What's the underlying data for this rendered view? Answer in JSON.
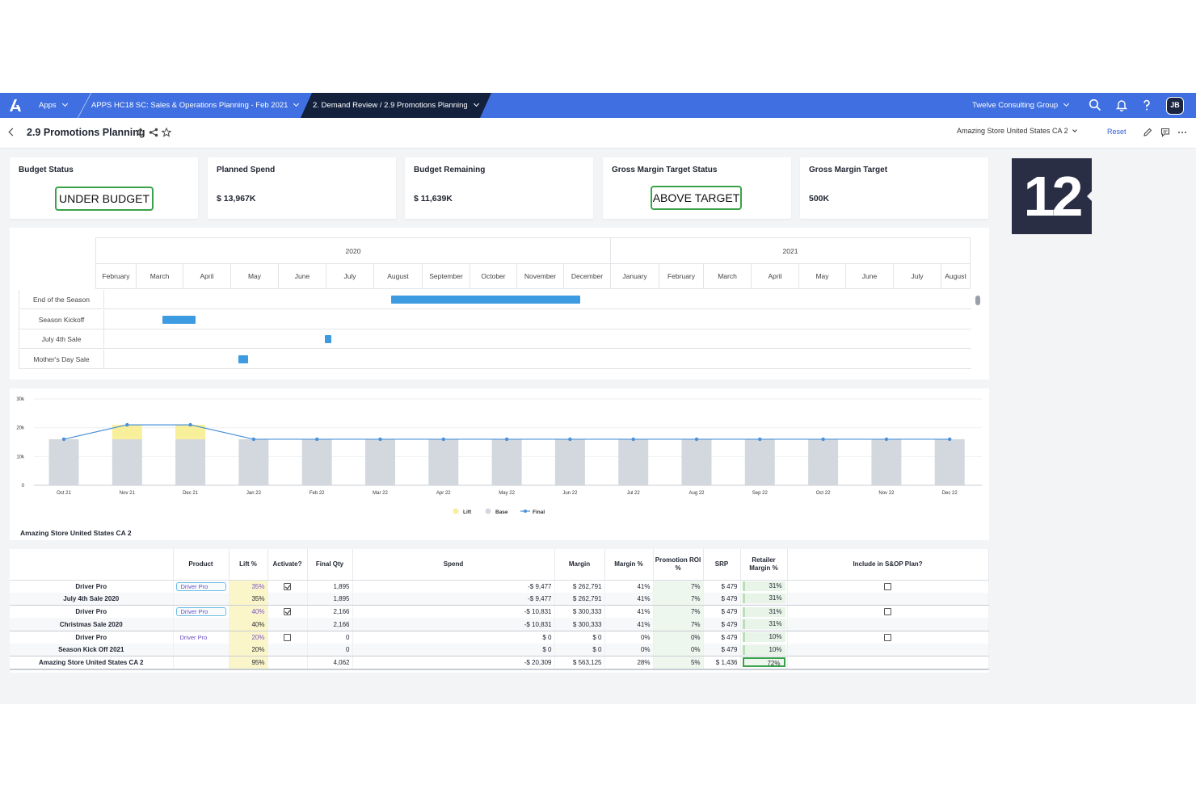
{
  "topbar": {
    "apps_label": "Apps",
    "model_label": "APPS HC18 SC: Sales & Operations Planning - Feb 2021",
    "page_path": "2. Demand Review / 2.9 Promotions Planning",
    "workspace_label": "Twelve Consulting Group",
    "avatar_initials": "JB",
    "icons": [
      "anaplan-logo-icon",
      "search-icon",
      "bell-icon",
      "help-icon"
    ]
  },
  "page_header": {
    "title": "2.9 Promotions Planning",
    "store_select": "Amazing Store United States CA 2",
    "reset_label": "Reset",
    "icons": [
      "back-chevron-icon",
      "refresh-icon",
      "share-icon",
      "star-icon",
      "edit-icon",
      "comment-icon",
      "more-icon"
    ]
  },
  "kpis": [
    {
      "label": "Budget Status",
      "badge": "UNDER BUDGET"
    },
    {
      "label": "Planned Spend",
      "value": "$ 13,967K"
    },
    {
      "label": "Budget Remaining",
      "value": "$ 11,639K"
    },
    {
      "label": "Gross Margin Target Status",
      "badge": "ABOVE TARGET"
    },
    {
      "label": "Gross Margin Target",
      "value": "500K"
    }
  ],
  "step_badge": "12",
  "gantt": {
    "years": [
      "2020",
      "2021"
    ],
    "months": [
      "February",
      "March",
      "April",
      "May",
      "June",
      "July",
      "August",
      "September",
      "October",
      "November",
      "December",
      "January",
      "February",
      "March",
      "April",
      "May",
      "June",
      "July",
      "August"
    ],
    "rows": [
      {
        "label": "End of the Season",
        "start_month": 6.35,
        "end_month": 10.35
      },
      {
        "label": "Season Kickoff",
        "start_month": 1.55,
        "end_month": 2.25
      },
      {
        "label": "July 4th Sale",
        "start_month": 4.97,
        "end_month": 5.1
      },
      {
        "label": "Mother's Day Sale",
        "start_month": 3.15,
        "end_month": 3.35
      }
    ],
    "bar_color": "#3d9be2"
  },
  "chart_data": {
    "type": "bar",
    "categories": [
      "Oct 21",
      "Nov 21",
      "Dec 21",
      "Jan 22",
      "Feb 22",
      "Mar 22",
      "Apr 22",
      "May 22",
      "Jun 22",
      "Jul 22",
      "Aug 22",
      "Sep 22",
      "Oct 22",
      "Nov 22",
      "Dec 22"
    ],
    "series": [
      {
        "name": "Base",
        "values": [
          16000,
          16000,
          16000,
          16000,
          16000,
          16000,
          16000,
          16000,
          16000,
          16000,
          16000,
          16000,
          16000,
          16000,
          16000
        ],
        "color": "#d3d8de"
      },
      {
        "name": "Lift",
        "values": [
          0,
          5000,
          5000,
          0,
          0,
          0,
          0,
          0,
          0,
          0,
          0,
          0,
          0,
          0,
          0
        ],
        "color": "#f7ef9a"
      },
      {
        "name": "Final",
        "values": [
          16000,
          21000,
          21000,
          16000,
          16000,
          16000,
          16000,
          16000,
          16000,
          16000,
          16000,
          16000,
          16000,
          16000,
          16000
        ],
        "color": "#4a90d9"
      }
    ],
    "y_ticks": [
      "0",
      "10k",
      "20k",
      "30k"
    ],
    "ylim": [
      0,
      30000
    ],
    "legend": [
      "Lift",
      "Base",
      "Final"
    ],
    "legend_position": "bottom-center",
    "caption": "Amazing Store United States CA 2"
  },
  "table": {
    "columns": [
      "",
      "Product",
      "Lift %",
      "Activate?",
      "Final Qty",
      "Spend",
      "Margin",
      "Margin %",
      "Promotion ROI %",
      "SRP",
      "Retailer Margin %",
      "Include in S&OP Plan?"
    ],
    "rows": [
      {
        "name": "Driver Pro",
        "product": "Driver Pro",
        "product_style": "input",
        "lift": "35%",
        "activate": true,
        "qty": "1,895",
        "spend": "-$ 9,477",
        "margin": "$ 262,791",
        "margin_pct": "41%",
        "roi": "7%",
        "srp": "$ 479",
        "rm": "31%",
        "include": false
      },
      {
        "name": "July 4th Sale 2020",
        "product": "",
        "lift": "35%",
        "qty": "1,895",
        "spend": "-$ 9,477",
        "margin": "$ 262,791",
        "margin_pct": "41%",
        "roi": "7%",
        "srp": "$ 479",
        "rm": "31%"
      },
      {
        "name": "Driver Pro",
        "product": "Driver Pro",
        "product_style": "input",
        "lift": "40%",
        "activate": true,
        "qty": "2,166",
        "spend": "-$ 10,831",
        "margin": "$ 300,333",
        "margin_pct": "41%",
        "roi": "7%",
        "srp": "$ 479",
        "rm": "31%",
        "include": false
      },
      {
        "name": "Christmas Sale 2020",
        "product": "",
        "lift": "40%",
        "qty": "2,166",
        "spend": "-$ 10,831",
        "margin": "$ 300,333",
        "margin_pct": "41%",
        "roi": "7%",
        "srp": "$ 479",
        "rm": "31%"
      },
      {
        "name": "Driver Pro",
        "product": "Driver Pro",
        "product_style": "plain",
        "lift": "20%",
        "activate": false,
        "qty": "0",
        "spend": "$ 0",
        "margin": "$ 0",
        "margin_pct": "0%",
        "roi": "0%",
        "srp": "$ 479",
        "rm": "10%",
        "include": false
      },
      {
        "name": "Season Kick Off 2021",
        "product": "",
        "lift": "20%",
        "qty": "0",
        "spend": "$ 0",
        "margin": "$ 0",
        "margin_pct": "0%",
        "roi": "0%",
        "srp": "$ 479",
        "rm": "10%"
      },
      {
        "name": "Amazing Store United States CA 2",
        "product": "",
        "lift": "95%",
        "qty": "4,062",
        "spend": "-$ 20,309",
        "margin": "$ 563,125",
        "margin_pct": "28%",
        "roi": "5%",
        "srp": "$ 1,436",
        "rm": "72%"
      }
    ]
  }
}
